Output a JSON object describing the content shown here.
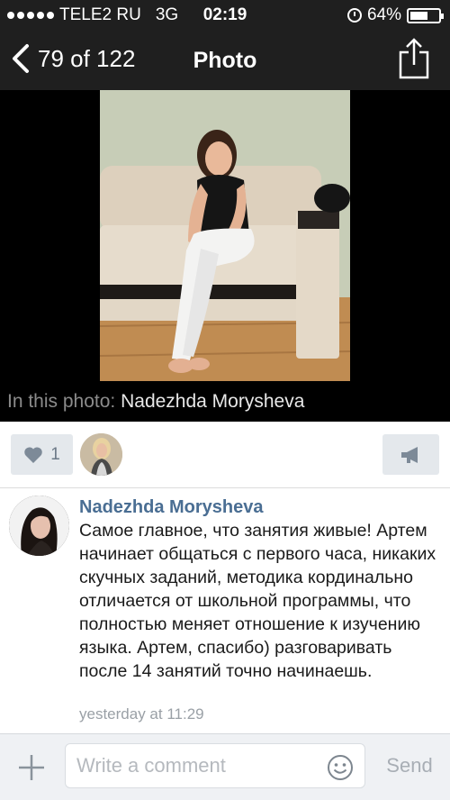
{
  "status_bar": {
    "carrier": "TELE2 RU",
    "network": "3G",
    "time": "02:19",
    "battery": "64%",
    "battery_level": 0.64
  },
  "nav": {
    "back_label": "79 of 122",
    "title": "Photo"
  },
  "photo": {
    "caption_prefix": "In this photo:",
    "tagged_name": "Nadezhda Morysheva"
  },
  "actions": {
    "like_count": "1"
  },
  "comment": {
    "author": "Nadezhda Morysheva",
    "text": "Самое главное, что занятия живые! Артем начинает общаться с первого часа, никаких скучных заданий, методика кординально отличается от школьной программы, что полностью меняет отношение к изучению языка. Артем, спасибо) разговаривать после 14 занятий точно начинаешь.",
    "time": "yesterday at 11:29"
  },
  "input_bar": {
    "placeholder": "Write a comment",
    "send_label": "Send"
  },
  "icons": {
    "back": "chevron-left-icon",
    "share": "share-icon",
    "like": "heart-icon",
    "repost": "megaphone-icon",
    "attach": "plus-icon",
    "emoji": "smiley-icon",
    "alarm": "alarm-icon",
    "battery": "battery-icon"
  },
  "colors": {
    "bar_background": "#1f1f1f",
    "link": "#4a6e93",
    "button_background": "#e4e8ec"
  }
}
